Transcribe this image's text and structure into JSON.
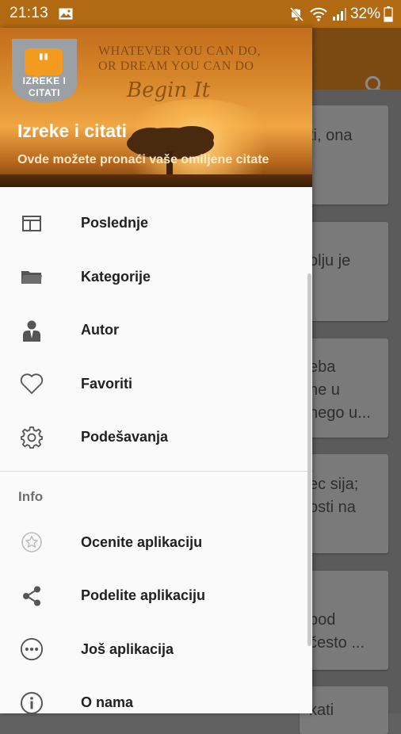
{
  "status_bar": {
    "time": "21:13",
    "battery": "32%"
  },
  "drawer": {
    "header": {
      "logo_line1": "IZREKE I",
      "logo_line2": "CITATI",
      "quote_line1": "WHATEVER YOU CAN DO,",
      "quote_line2": "OR DREAM YOU CAN DO",
      "quote_line3": "Begin It",
      "title": "Izreke i citati",
      "subtitle": "Ovde možete pronaći vaše omiljene citate"
    },
    "items": [
      {
        "label": "Poslednje",
        "icon": "recent-icon"
      },
      {
        "label": "Kategorije",
        "icon": "folder-icon"
      },
      {
        "label": "Autor",
        "icon": "person-icon"
      },
      {
        "label": "Favoriti",
        "icon": "heart-icon"
      },
      {
        "label": "Podešavanja",
        "icon": "gear-icon"
      }
    ],
    "section_label": "Info",
    "info_items": [
      {
        "label": "Ocenite aplikaciju",
        "icon": "star-badge-icon"
      },
      {
        "label": "Podelite aplikaciju",
        "icon": "share-icon"
      },
      {
        "label": "Još aplikacija",
        "icon": "more-circle-icon"
      },
      {
        "label": "O nama",
        "icon": "info-icon"
      }
    ]
  },
  "background": {
    "cards": [
      {
        "lines": [
          "ti, ona"
        ]
      },
      {
        "lines": [
          "olju je"
        ]
      },
      {
        "lines": [
          "eba",
          "ne u",
          "nego u..."
        ]
      },
      {
        "lines": [
          "ec sija;",
          "osti na"
        ]
      },
      {
        "lines": [
          "pod",
          "često ..."
        ]
      },
      {
        "lines": [
          "kati"
        ]
      }
    ]
  }
}
